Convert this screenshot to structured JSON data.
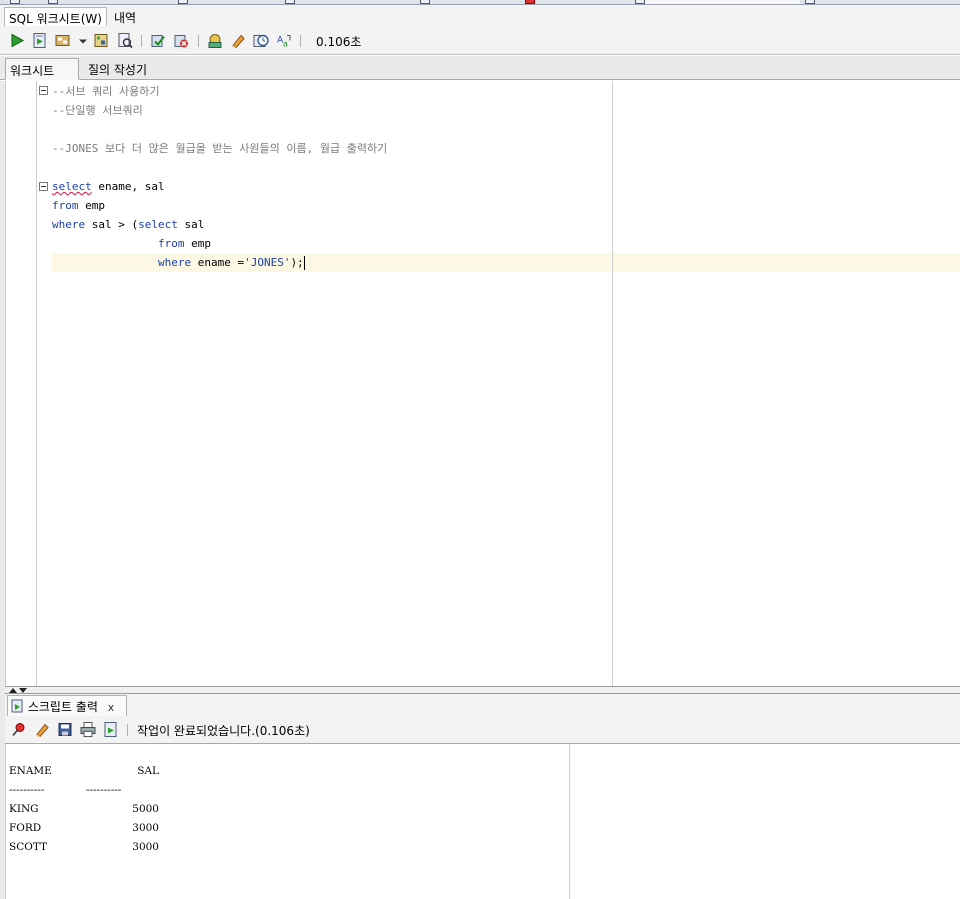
{
  "sub_tabs": [
    {
      "label": "SQL 워크시트(W)",
      "active": true
    },
    {
      "label": "내역",
      "active": false
    }
  ],
  "toolbar": {
    "elapsed": "0.106초",
    "icons": [
      "run-statement-icon",
      "run-script-icon",
      "autotrace-icon",
      "dropdown-arrow-icon",
      "explain-plan-icon",
      "sql-tuning-icon",
      "commit-icon",
      "rollback-icon",
      "unshared-sql-icon",
      "clear-icon",
      "history-icon",
      "format-icon"
    ]
  },
  "worksheet_tabs": [
    {
      "label": "워크시트",
      "active": true
    },
    {
      "label": "질의 작성기",
      "active": false
    }
  ],
  "editor": {
    "lines": [
      {
        "type": "comment",
        "text": "--서브 쿼리 사용하기"
      },
      {
        "type": "comment",
        "text": "--단일행 서브쿼리"
      },
      {
        "type": "blank",
        "text": ""
      },
      {
        "type": "comment",
        "text": "--JONES 보다 더 많은 월급을 받는 사원들의 이름, 월급 출력하기"
      },
      {
        "type": "blank",
        "text": ""
      },
      {
        "type": "code",
        "parts": [
          [
            "kw",
            "select"
          ],
          [
            "plain",
            " ename, sal"
          ]
        ]
      },
      {
        "type": "code",
        "parts": [
          [
            "kw",
            "from"
          ],
          [
            "plain",
            " emp"
          ]
        ]
      },
      {
        "type": "code",
        "parts": [
          [
            "kw",
            "where"
          ],
          [
            "plain",
            " sal > ("
          ],
          [
            "kw",
            "select"
          ],
          [
            "plain",
            " sal"
          ]
        ]
      },
      {
        "type": "code",
        "parts": [
          [
            "plain",
            "                "
          ],
          [
            "kw",
            "from"
          ],
          [
            "plain",
            " emp"
          ]
        ]
      },
      {
        "type": "code",
        "parts": [
          [
            "plain",
            "                "
          ],
          [
            "kw",
            "where"
          ],
          [
            "plain",
            " ename ="
          ],
          [
            "str",
            "'JONES'"
          ],
          [
            "plain",
            ");"
          ]
        ]
      }
    ]
  },
  "output": {
    "tab_label": "스크립트 출력",
    "close_label": "x",
    "status": "작업이 완료되었습니다.(0.106초)",
    "header": [
      "ENAME",
      "SAL"
    ],
    "separator": [
      "----------",
      "----------"
    ],
    "rows": [
      [
        "KING",
        "5000"
      ],
      [
        "FORD",
        "3000"
      ],
      [
        "SCOTT",
        "3000"
      ]
    ]
  }
}
